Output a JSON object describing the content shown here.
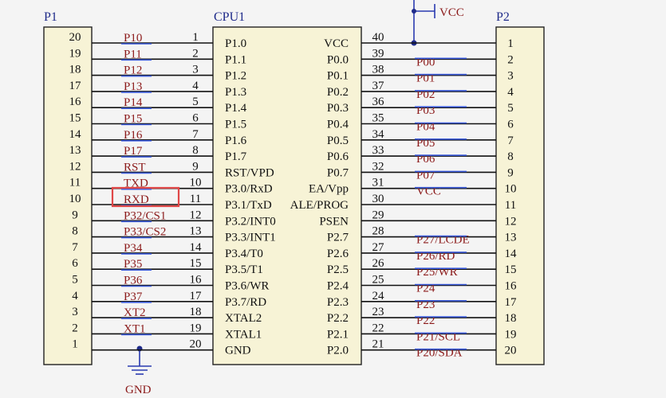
{
  "connectors": {
    "p1_label": "P1",
    "p2_label": "P2"
  },
  "cpu": {
    "label": "CPU1",
    "left_pins": [
      {
        "num": "1",
        "name": "P1.0",
        "net": "P10"
      },
      {
        "num": "2",
        "name": "P1.1",
        "net": "P11"
      },
      {
        "num": "3",
        "name": "P1.2",
        "net": "P12"
      },
      {
        "num": "4",
        "name": "P1.3",
        "net": "P13"
      },
      {
        "num": "5",
        "name": "P1.4",
        "net": "P14"
      },
      {
        "num": "6",
        "name": "P1.5",
        "net": "P15"
      },
      {
        "num": "7",
        "name": "P1.6",
        "net": "P16"
      },
      {
        "num": "8",
        "name": "P1.7",
        "net": "P17"
      },
      {
        "num": "9",
        "name": "RST/VPD",
        "net": "RST"
      },
      {
        "num": "10",
        "name": "P3.0/RxD",
        "net": "TXD"
      },
      {
        "num": "11",
        "name": "P3.1/TxD",
        "net": "RXD"
      },
      {
        "num": "12",
        "name": "P3.2/INT0",
        "net": "P32/CS1"
      },
      {
        "num": "13",
        "name": "P3.3/INT1",
        "net": "P33/CS2"
      },
      {
        "num": "14",
        "name": "P3.4/T0",
        "net": "P34"
      },
      {
        "num": "15",
        "name": "P3.5/T1",
        "net": "P35"
      },
      {
        "num": "16",
        "name": "P3.6/WR",
        "net": "P36"
      },
      {
        "num": "17",
        "name": "P3.7/RD",
        "net": "P37"
      },
      {
        "num": "18",
        "name": "XTAL2",
        "net": "XT2"
      },
      {
        "num": "19",
        "name": "XTAL1",
        "net": "XT1"
      },
      {
        "num": "20",
        "name": "GND",
        "net": ""
      }
    ],
    "right_pins": [
      {
        "num": "40",
        "name": "VCC",
        "net": ""
      },
      {
        "num": "39",
        "name": "P0.0",
        "net": "P00"
      },
      {
        "num": "38",
        "name": "P0.1",
        "net": "P01"
      },
      {
        "num": "37",
        "name": "P0.2",
        "net": "P02"
      },
      {
        "num": "36",
        "name": "P0.3",
        "net": "P03"
      },
      {
        "num": "35",
        "name": "P0.4",
        "net": "P04"
      },
      {
        "num": "34",
        "name": "P0.5",
        "net": "P05"
      },
      {
        "num": "33",
        "name": "P0.6",
        "net": "P06"
      },
      {
        "num": "32",
        "name": "P0.7",
        "net": "P07"
      },
      {
        "num": "31",
        "name": "EA/Vpp",
        "net": "VCC"
      },
      {
        "num": "30",
        "name": "ALE/PROG",
        "net": ""
      },
      {
        "num": "29",
        "name": "PSEN",
        "net": ""
      },
      {
        "num": "28",
        "name": "P2.7",
        "net": "P27/LCDE"
      },
      {
        "num": "27",
        "name": "P2.6",
        "net": "P26/RD"
      },
      {
        "num": "26",
        "name": "P2.5",
        "net": "P25/WR"
      },
      {
        "num": "25",
        "name": "P2.4",
        "net": "P24"
      },
      {
        "num": "24",
        "name": "P2.3",
        "net": "P23"
      },
      {
        "num": "23",
        "name": "P2.2",
        "net": "P22"
      },
      {
        "num": "22",
        "name": "P2.1",
        "net": "P21/SCL"
      },
      {
        "num": "21",
        "name": "P2.0",
        "net": "P20/SDA"
      }
    ]
  },
  "p1_numbers": [
    "20",
    "19",
    "18",
    "17",
    "16",
    "15",
    "14",
    "13",
    "12",
    "11",
    "10",
    "9",
    "8",
    "7",
    "6",
    "5",
    "4",
    "3",
    "2",
    "1"
  ],
  "p2_numbers": [
    "1",
    "2",
    "3",
    "4",
    "5",
    "6",
    "7",
    "8",
    "9",
    "10",
    "11",
    "12",
    "13",
    "14",
    "15",
    "16",
    "17",
    "18",
    "19",
    "20"
  ],
  "power": {
    "vcc_label": "VCC",
    "gnd_label": "GND"
  },
  "highlight": {
    "net": "RXD",
    "color": "#e04848"
  },
  "colors": {
    "net_text": "#8b1a1a",
    "net_underline": "#3b5bdb",
    "component_fill": "#f7f3d6",
    "connector_label": "#1f2b8a"
  }
}
